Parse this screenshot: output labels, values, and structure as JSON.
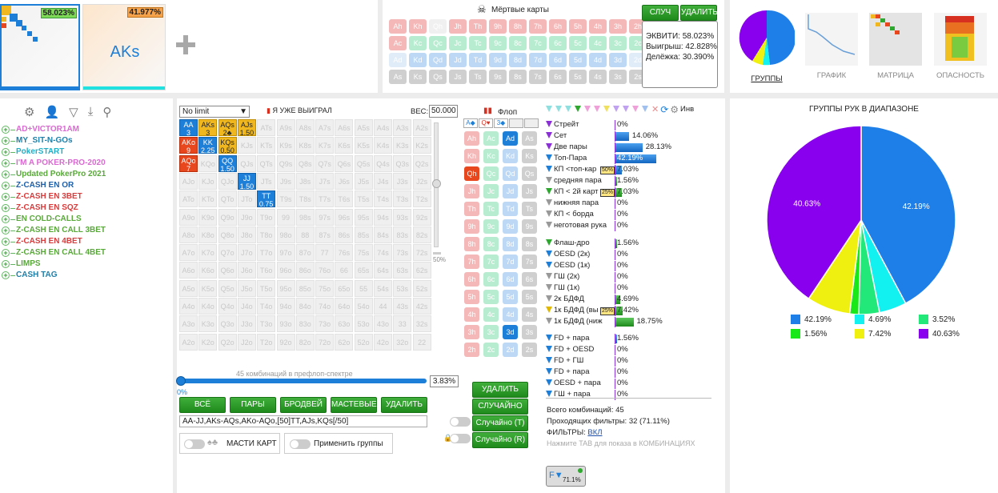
{
  "top_left": {
    "range1_pct": "58.023%",
    "range2_pct": "41.977%",
    "range2_hand": "AKs",
    "add_label": "+"
  },
  "dead_cards": {
    "title": "Мёртвые карты",
    "skull": "☠",
    "rows": [
      [
        "Ah",
        "Kh",
        "Qh",
        "Jh",
        "Th",
        "9h",
        "8h",
        "7h",
        "6h",
        "5h",
        "4h",
        "3h",
        "2h"
      ],
      [
        "Ac",
        "Kc",
        "Qc",
        "Jc",
        "Tc",
        "9c",
        "8c",
        "7c",
        "6c",
        "5c",
        "4c",
        "3c",
        "2c"
      ],
      [
        "Ad",
        "Kd",
        "Qd",
        "Jd",
        "Td",
        "9d",
        "8d",
        "7d",
        "6d",
        "5d",
        "4d",
        "3d",
        "2d"
      ],
      [
        "As",
        "Ks",
        "Qs",
        "Js",
        "Ts",
        "9s",
        "8s",
        "7s",
        "6s",
        "5s",
        "4s",
        "3s",
        "2s"
      ]
    ]
  },
  "equity_box": {
    "random_btn": "СЛУЧ",
    "delete_btn": "УДАЛИТЬ",
    "equity_label": "ЭКВИТИ:",
    "equity_value": "58.023%",
    "win_label": "Выигрыш:",
    "win_value": "42.828%",
    "split_label": "Делёжка:",
    "split_value": "30.390%"
  },
  "view_tabs": [
    {
      "label": "ГРУППЫ"
    },
    {
      "label": "ГРАФИК"
    },
    {
      "label": "МАТРИЦА"
    },
    {
      "label": "ОПАСНОСТЬ"
    }
  ],
  "tree": [
    {
      "label": "AD+VICTOR1AM",
      "color": "#d86bd0"
    },
    {
      "label": "MY_SIT-N-GOs",
      "color": "#1f7fa8"
    },
    {
      "label": "PokerSTART",
      "color": "#1fb0c8"
    },
    {
      "label": "I'M A POKER-PRO-2020",
      "color": "#d86bd0"
    },
    {
      "label": "Updated PokerPro 2021",
      "color": "#5aa83c"
    },
    {
      "label": "Z-CASH EN OR",
      "color": "#1f5fa8"
    },
    {
      "label": "Z-CASH EN 3BET",
      "color": "#d83c3c"
    },
    {
      "label": "Z-CASH EN SQZ",
      "color": "#d83c3c"
    },
    {
      "label": "EN COLD-CALLS",
      "color": "#5aa83c"
    },
    {
      "label": "Z-CASH EN CALL 3BET",
      "color": "#5aa83c"
    },
    {
      "label": "Z-CASH EN 4BET",
      "color": "#d83c3c"
    },
    {
      "label": "Z-CASH EN CALL 4BET",
      "color": "#5aa83c"
    },
    {
      "label": "LIMPS",
      "color": "#5aa83c"
    },
    {
      "label": "CASH TAG",
      "color": "#1f7fa8"
    }
  ],
  "matrix": {
    "limit": "No limit",
    "already_won": "Я УЖЕ ВЫИГРАЛ",
    "weight_label": "ВЕС:",
    "weight_value": "50.000",
    "ranks": [
      "A",
      "K",
      "Q",
      "J",
      "T",
      "9",
      "8",
      "7",
      "6",
      "5",
      "4",
      "3",
      "2"
    ],
    "selected": [
      {
        "r": 0,
        "c": 0,
        "hand": "AA",
        "val": "3",
        "col": "blue"
      },
      {
        "r": 0,
        "c": 1,
        "hand": "AKs",
        "val": "3",
        "col": "gold"
      },
      {
        "r": 0,
        "c": 2,
        "hand": "AQs",
        "val": "2♣",
        "col": "gold"
      },
      {
        "r": 0,
        "c": 3,
        "hand": "AJs",
        "val": "1.50",
        "col": "gold"
      },
      {
        "r": 1,
        "c": 0,
        "hand": "AKo",
        "val": "9",
        "col": "red"
      },
      {
        "r": 1,
        "c": 1,
        "hand": "KK",
        "val": "2.25",
        "col": "blue"
      },
      {
        "r": 1,
        "c": 2,
        "hand": "KQs",
        "val": "0.50",
        "col": "gold"
      },
      {
        "r": 2,
        "c": 0,
        "hand": "AQo",
        "val": "7",
        "col": "red"
      },
      {
        "r": 2,
        "c": 2,
        "hand": "QQ",
        "val": "1.50",
        "col": "blue"
      },
      {
        "r": 3,
        "c": 3,
        "hand": "JJ",
        "val": "1.50",
        "col": "blue"
      },
      {
        "r": 4,
        "c": 4,
        "hand": "TT",
        "val": "0.75",
        "col": "blue"
      }
    ],
    "combos_caption": "45 комбинаций в префлоп-спектре",
    "slider_left": "0%",
    "slider_pct": "3.83%",
    "v_slider_pct": "50%",
    "buttons": [
      "ВСЁ",
      "ПАРЫ",
      "БРОДВЕЙ",
      "МАСТЕВЫЕ",
      "УДАЛИТЬ"
    ],
    "range_text": "AA-JJ,AKs-AQs,AKo-AQo,[50]TT,AJs,KQs[/50]",
    "suits_label": "МАСТИ КАРТ",
    "apply_groups": "Применить группы"
  },
  "flop": {
    "title": "Флоп",
    "slot1": "A◆",
    "slot2": "Q♥",
    "slot3": "3◆",
    "ranks": [
      "A",
      "K",
      "Q",
      "J",
      "T",
      "9",
      "8",
      "7",
      "6",
      "5",
      "4",
      "3",
      "2"
    ],
    "suits": [
      "h",
      "c",
      "d",
      "s"
    ],
    "selected": [
      {
        "r": 0,
        "s": 2
      },
      {
        "r": 2,
        "s": 0
      },
      {
        "r": 11,
        "s": 2
      }
    ],
    "delete_btn": "УДАЛИТЬ",
    "random_btn": "СЛУЧАЙНО",
    "random_t": "Случайно (T)",
    "random_r": "Случайно (R)"
  },
  "filters": {
    "inv_label": "Инв",
    "made": [
      {
        "label": "Стрейт",
        "val": "0%",
        "pct": 0,
        "c": "#8b2fd8"
      },
      {
        "label": "Сет",
        "val": "14.06%",
        "pct": 14.06,
        "c": "#8b2fd8"
      },
      {
        "label": "Две пары",
        "val": "28.13%",
        "pct": 28.13,
        "c": "#8b2fd8"
      },
      {
        "label": "Топ-Пара",
        "val": "42.19%",
        "pct": 42.19,
        "c": "#1e7fd8"
      },
      {
        "label": "КП <топ-кар",
        "val": "7.03%",
        "pct": 7.03,
        "c": "#1e7fd8",
        "tag": "50%"
      },
      {
        "label": "средняя пара",
        "val": "1.56%",
        "pct": 1.56,
        "c": "#999"
      },
      {
        "label": "КП < 2й карт",
        "val": "7.03%",
        "pct": 7.03,
        "c": "#2fa82f",
        "tag": "25%"
      },
      {
        "label": "нижняя пара",
        "val": "0%",
        "pct": 0,
        "c": "#999"
      },
      {
        "label": "КП < борда",
        "val": "0%",
        "pct": 0,
        "c": "#999"
      },
      {
        "label": "неготовая рука",
        "val": "0%",
        "pct": 0,
        "c": "#999"
      }
    ],
    "draws": [
      {
        "label": "Флаш-дро",
        "val": "1.56%",
        "pct": 1.56,
        "c": "#2fa82f"
      },
      {
        "label": "OESD (2к)",
        "val": "0%",
        "pct": 0,
        "c": "#1e7fd8"
      },
      {
        "label": "OESD (1к)",
        "val": "0%",
        "pct": 0,
        "c": "#1e7fd8"
      },
      {
        "label": "ГШ (2к)",
        "val": "0%",
        "pct": 0,
        "c": "#999"
      },
      {
        "label": "ГШ (1к)",
        "val": "0%",
        "pct": 0,
        "c": "#999"
      },
      {
        "label": "2к БДФД",
        "val": "4.69%",
        "pct": 4.69,
        "c": "#999"
      },
      {
        "label": "1к БДФД (вы",
        "val": "7.42%",
        "pct": 7.42,
        "c": "#e0b800",
        "tag": "25%"
      },
      {
        "label": "1к БДФД (ниж",
        "val": "18.75%",
        "pct": 18.75,
        "c": "#999"
      }
    ],
    "combo": [
      {
        "label": "FD + пара",
        "val": "1.56%",
        "pct": 1.56,
        "c": "#1e7fd8"
      },
      {
        "label": "FD + OESD",
        "val": "0%",
        "pct": 0,
        "c": "#1e7fd8"
      },
      {
        "label": "FD + ГШ",
        "val": "0%",
        "pct": 0,
        "c": "#1e7fd8"
      },
      {
        "label": "FD + пара",
        "val": "0%",
        "pct": 0,
        "c": "#1e7fd8"
      },
      {
        "label": "OESD + пара",
        "val": "0%",
        "pct": 0,
        "c": "#1e7fd8"
      },
      {
        "label": "ГШ + пара",
        "val": "0%",
        "pct": 0,
        "c": "#1e7fd8"
      }
    ],
    "total": "Всего комбинаций: 45",
    "passing": "Проходящих фильтры: 32 (71.11%)",
    "filters_label": "ФИЛЬТРЫ:",
    "filters_state": "ВКЛ",
    "hint": "Нажмите TAB для показа в КОМБИНАЦИЯХ",
    "badge": "71.1%"
  },
  "chart_data": {
    "type": "pie",
    "title": "ГРУППЫ РУК В ДИАПАЗОНЕ",
    "slices": [
      {
        "label": "42.19%",
        "value": 42.19,
        "color": "#1e7fe8"
      },
      {
        "label": "4.69%",
        "value": 4.69,
        "color": "#12f0f0"
      },
      {
        "label": "3.52%",
        "value": 3.52,
        "color": "#22e87a"
      },
      {
        "label": "1.56%",
        "value": 1.56,
        "color": "#18e818"
      },
      {
        "label": "7.42%",
        "value": 7.42,
        "color": "#f0f010"
      },
      {
        "label": "40.63%",
        "value": 40.63,
        "color": "#8800ee"
      }
    ],
    "legend": [
      "42.19%",
      "4.69%",
      "3.52%",
      "1.56%",
      "7.42%",
      "40.63%"
    ]
  }
}
